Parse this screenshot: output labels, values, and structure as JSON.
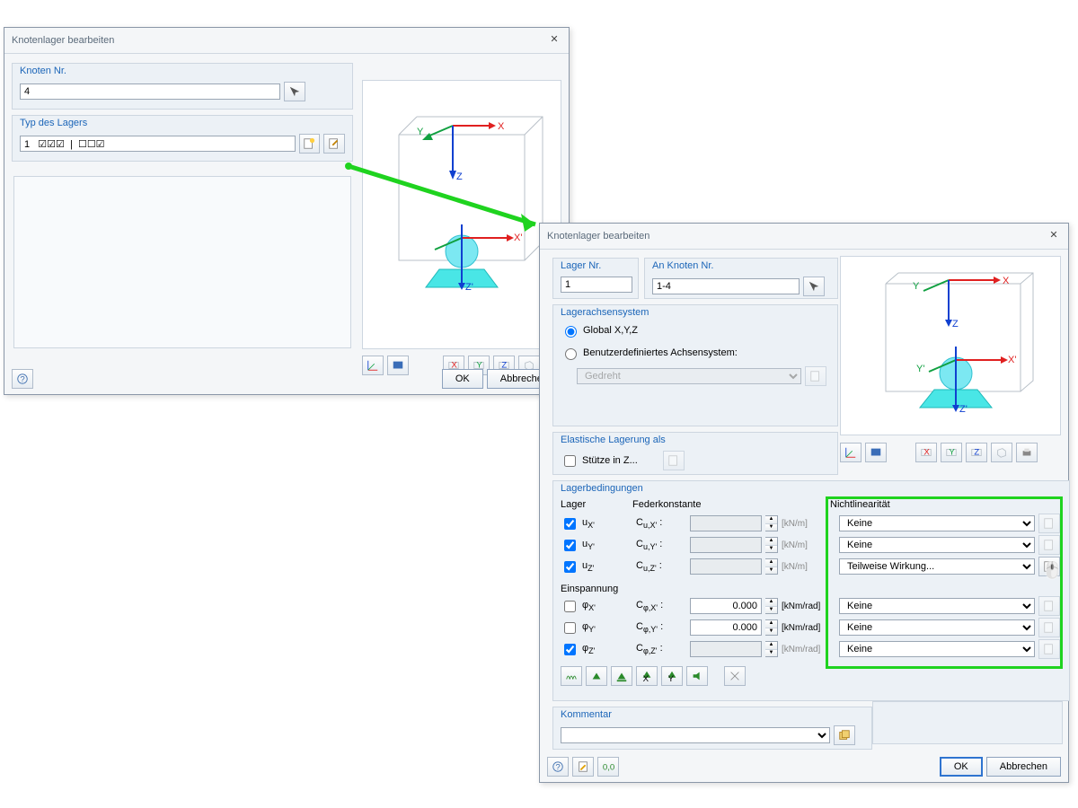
{
  "dlg1": {
    "title": "Knotenlager bearbeiten",
    "node_no_label": "Knoten Nr.",
    "node_no_value": "4",
    "type_label": "Typ des Lagers",
    "type_value": "1   ☑☑☑  |  ☐☐☑",
    "ok": "OK",
    "cancel": "Abbrechen"
  },
  "dlg2": {
    "title": "Knotenlager bearbeiten",
    "lager_nr_label": "Lager Nr.",
    "lager_nr_value": "1",
    "an_knoten_label": "An Knoten Nr.",
    "an_knoten_value": "1-4",
    "axis_sys_label": "Lagerachsensystem",
    "global_label": "Global X,Y,Z",
    "user_axis_label": "Benutzerdefiniertes Achsensystem:",
    "user_axis_value": "Gedreht",
    "elastic_label": "Elastische Lagerung als",
    "stutze_label": "Stütze in Z...",
    "conditions_label": "Lagerbedingungen",
    "col_lager": "Lager",
    "col_feder": "Federkonstante",
    "col_nonlin": "Nichtlinearität",
    "ux": "uX'",
    "uy": "uY'",
    "uz": "uZ'",
    "cux": "Cu,X' :",
    "cuy": "Cu,Y' :",
    "cuz": "Cu,Z' :",
    "unit_lin": "[kN/m]",
    "einsp": "Einspannung",
    "phix": "φX'",
    "phiy": "φY'",
    "phiz": "φZ'",
    "cphix": "Cφ,X' :",
    "cphiy": "Cφ,Y' :",
    "cphiz": "Cφ,Z' :",
    "unit_rot": "[kNm/rad]",
    "val0": "0.000",
    "keine": "Keine",
    "teilweise": "Teilweise Wirkung...",
    "kommentar_label": "Kommentar",
    "ok": "OK",
    "cancel": "Abbrechen"
  },
  "axes": {
    "x": "X",
    "y": "Y",
    "z": "Z",
    "xp": "X'",
    "yp": "Y'",
    "zp": "Z'"
  }
}
